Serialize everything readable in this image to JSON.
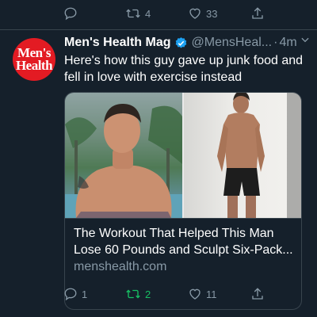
{
  "top_actions": {
    "reply_count": "",
    "retweet_count": "4",
    "like_count": "33"
  },
  "tweet": {
    "avatar_line1": "Men's",
    "avatar_line2": "Health",
    "author_name": "Men's Health Mag",
    "handle": "@MensHeal...",
    "separator": "·",
    "time": "4m",
    "text": "Here's how this guy gave up junk food and fell in love with exercise instead",
    "card": {
      "title": "The Workout That Helped This Man Lose 60 Pounds and Sculpt Six-Pack...",
      "domain": "menshealth.com"
    },
    "actions": {
      "reply_count": "1",
      "retweet_count": "2",
      "like_count": "11"
    }
  },
  "colors": {
    "background": "#15202b",
    "secondary_text": "#8899a6",
    "retweet_active": "#17bf63",
    "verified": "#1da1f2",
    "brand_red": "#e31b23"
  },
  "icons": [
    "reply-icon",
    "retweet-icon",
    "like-icon",
    "share-icon",
    "verified-icon",
    "chevron-down-icon"
  ]
}
